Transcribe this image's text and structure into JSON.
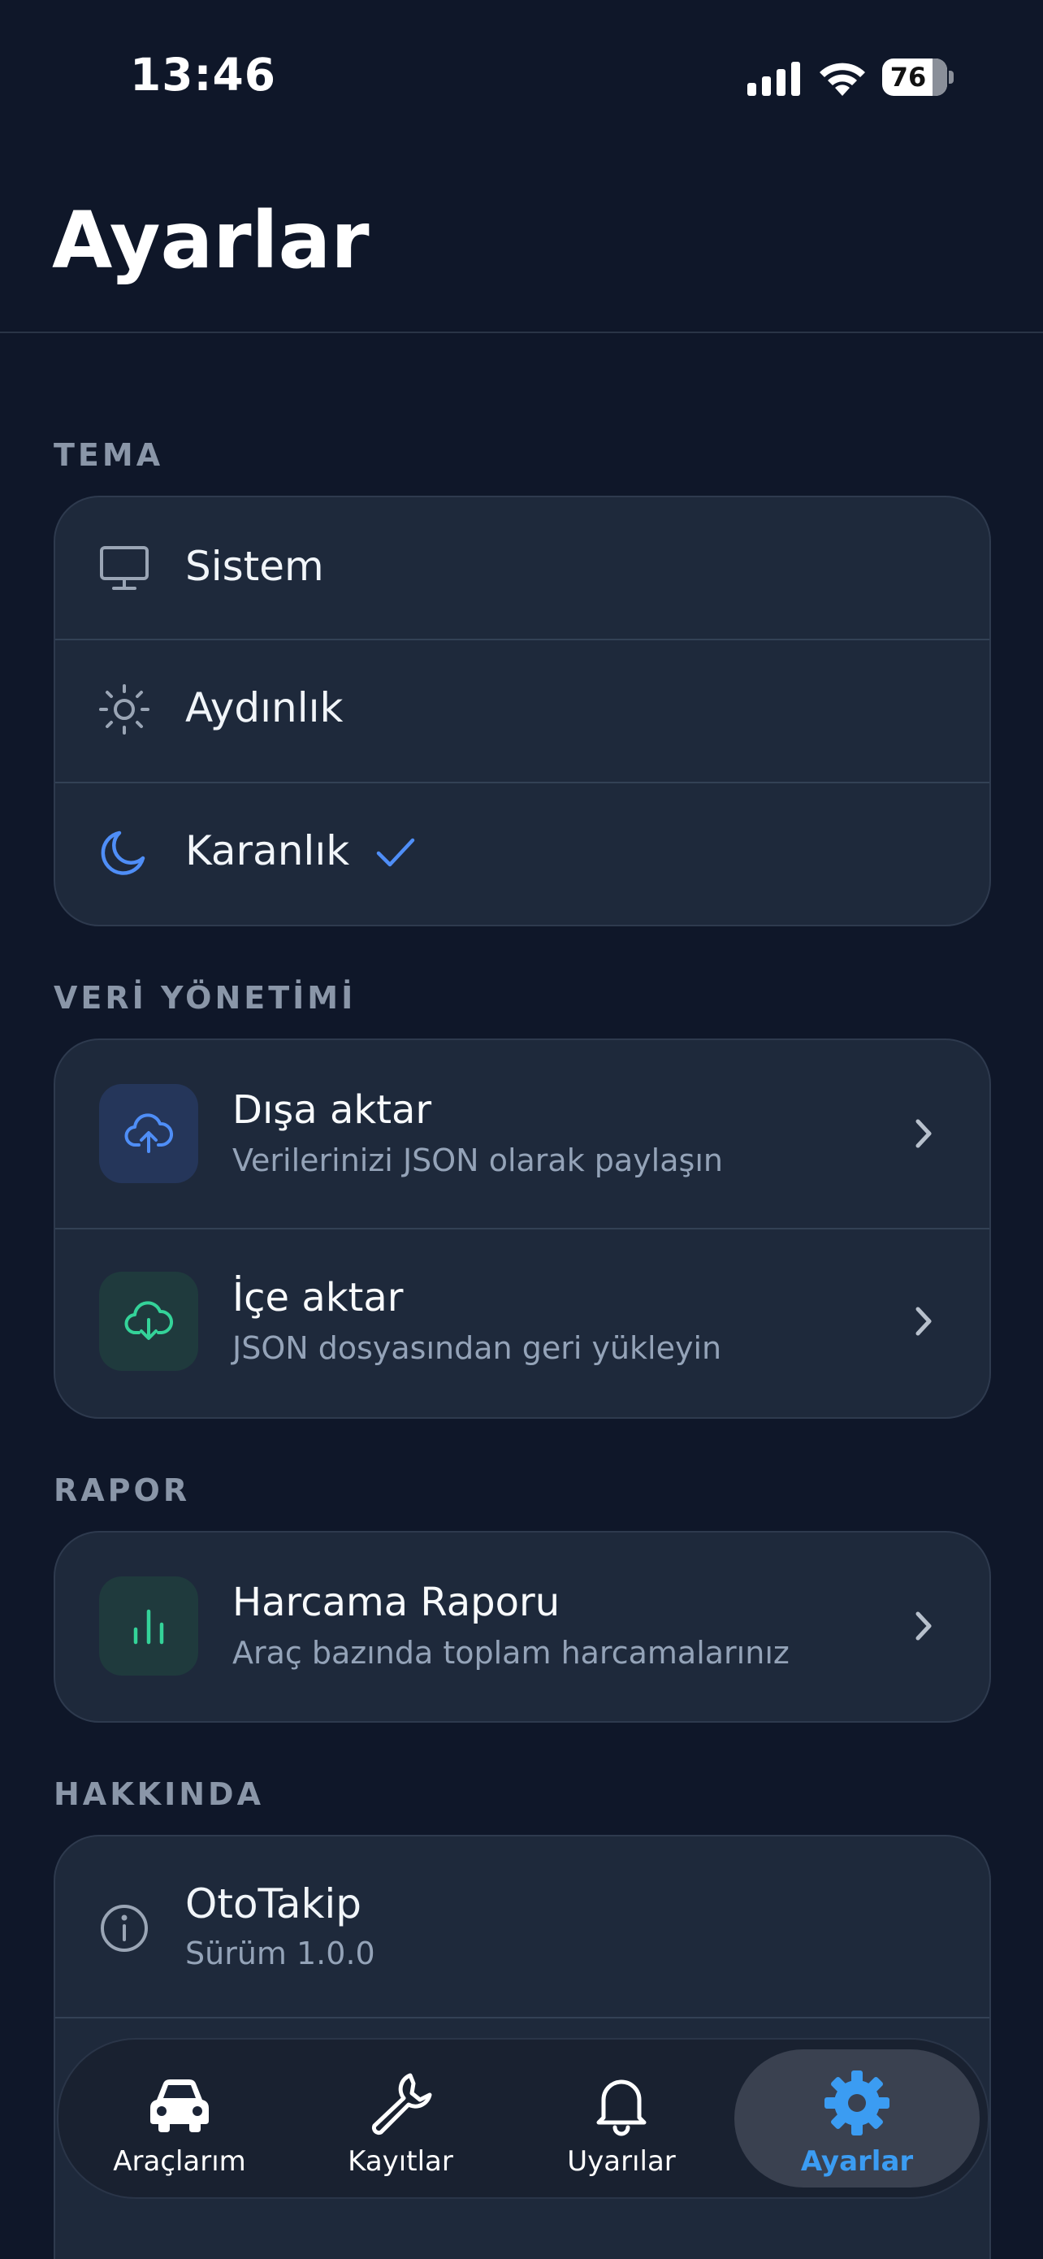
{
  "status_bar": {
    "time": "13:46",
    "battery": "76"
  },
  "header": {
    "title": "Ayarlar"
  },
  "theme": {
    "section_label": "TEMA",
    "options": [
      {
        "label": "Sistem",
        "icon": "monitor-icon",
        "selected": false
      },
      {
        "label": "Aydınlık",
        "icon": "sun-icon",
        "selected": false
      },
      {
        "label": "Karanlık",
        "icon": "moon-icon",
        "selected": true
      }
    ]
  },
  "data_management": {
    "section_label": "VERİ YÖNETİMİ",
    "items": [
      {
        "title": "Dışa aktar",
        "subtitle": "Verilerinizi JSON olarak paylaşın",
        "icon": "cloud-upload-icon"
      },
      {
        "title": "İçe aktar",
        "subtitle": "JSON dosyasından geri yükleyin",
        "icon": "cloud-download-icon"
      }
    ]
  },
  "report": {
    "section_label": "RAPOR",
    "items": [
      {
        "title": "Harcama Raporu",
        "subtitle": "Araç bazında toplam harcamalarınız",
        "icon": "bar-chart-icon"
      }
    ]
  },
  "about": {
    "section_label": "HAKKINDA",
    "app_name": "OtoTakip",
    "version": "Sürüm 1.0.0"
  },
  "tab_bar": {
    "tabs": [
      {
        "label": "Araçlarım",
        "icon": "car-icon",
        "active": false
      },
      {
        "label": "Kayıtlar",
        "icon": "wrench-icon",
        "active": false
      },
      {
        "label": "Uyarılar",
        "icon": "bell-icon",
        "active": false
      },
      {
        "label": "Ayarlar",
        "icon": "gear-icon",
        "active": true
      }
    ]
  },
  "colors": {
    "background": "#0f1729",
    "card": "#1e293b",
    "accent_blue": "#3b82f6",
    "accent_green": "#34d399",
    "active_tab": "#3b9cf2"
  }
}
